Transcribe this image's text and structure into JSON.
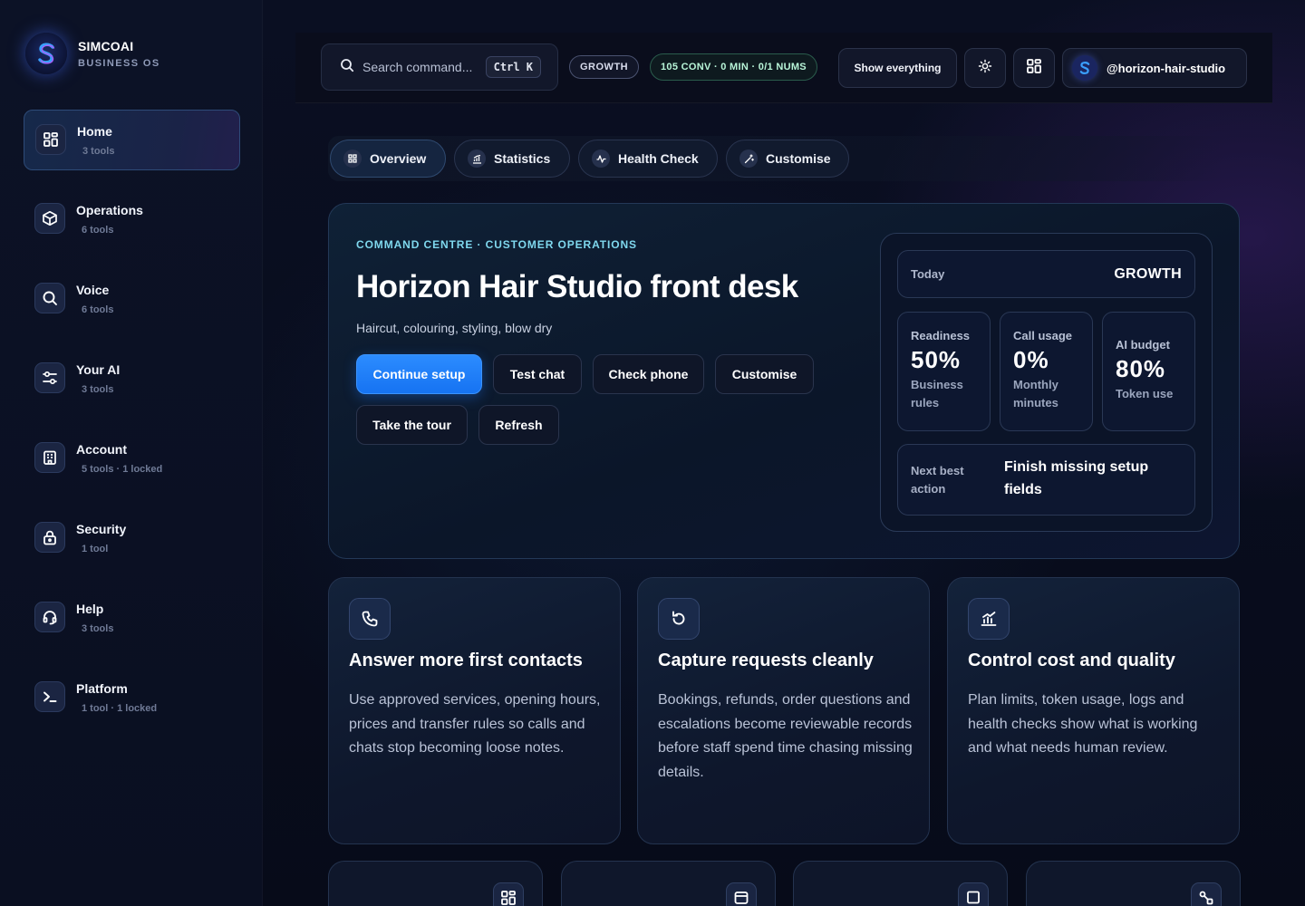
{
  "brand": {
    "name": "SIMCOAI",
    "subtitle": "BUSINESS OS"
  },
  "sidebar": {
    "items": [
      {
        "title": "Home",
        "sub": "3 tools",
        "icon": "grid-icon",
        "active": true
      },
      {
        "title": "Operations",
        "sub": "6 tools",
        "icon": "box-icon"
      },
      {
        "title": "Voice",
        "sub": "6 tools",
        "icon": "search-icon"
      },
      {
        "title": "Your AI",
        "sub": "3 tools",
        "icon": "sliders-icon"
      },
      {
        "title": "Account",
        "sub": "5 tools · 1 locked",
        "icon": "building-icon"
      },
      {
        "title": "Security",
        "sub": "1 tool",
        "icon": "lock-icon"
      },
      {
        "title": "Help",
        "sub": "3 tools",
        "icon": "headset-icon"
      },
      {
        "title": "Platform",
        "sub": "1 tool · 1 locked",
        "icon": "terminal-icon"
      }
    ]
  },
  "topbar": {
    "search_placeholder": "Search command...",
    "shortcut": "Ctrl K",
    "plan_badge": "GROWTH",
    "usage_badge": "105 CONV · 0 MIN · 0/1 NUMS",
    "show_button": "Show everything",
    "profile": "@horizon-hair-studio"
  },
  "tabs": [
    {
      "label": "Overview",
      "icon": "overview-icon"
    },
    {
      "label": "Statistics",
      "icon": "chart-icon"
    },
    {
      "label": "Health Check",
      "icon": "pulse-icon"
    },
    {
      "label": "Customise",
      "icon": "wand-icon"
    }
  ],
  "hero": {
    "eyebrow": "COMMAND CENTRE · CUSTOMER OPERATIONS",
    "title": "Horizon Hair Studio front desk",
    "subtitle": "Haircut, colouring, styling, blow dry",
    "buttons": {
      "continue": "Continue setup",
      "test_chat": "Test chat",
      "check_phone": "Check phone",
      "customise": "Customise",
      "tour": "Take the tour",
      "refresh": "Refresh"
    }
  },
  "stats": {
    "today_label": "Today",
    "today_value": "GROWTH",
    "readiness": {
      "label": "Readiness",
      "value": "50%",
      "sub": "Business rules"
    },
    "call_usage": {
      "label": "Call usage",
      "value": "0%",
      "sub": "Monthly minutes"
    },
    "ai_budget": {
      "label": "AI budget",
      "value": "80%",
      "sub": "Token use"
    },
    "next_label": "Next best action",
    "next_value": "Finish missing setup fields"
  },
  "cards": [
    {
      "title": "Answer more first contacts",
      "body": "Use approved services, opening hours, prices and transfer rules so calls and chats stop becoming loose notes.",
      "icon": "phone-icon"
    },
    {
      "title": "Capture requests cleanly",
      "body": "Bookings, refunds, order questions and escalations become reviewable records before staff spend time chasing missing details.",
      "icon": "refresh-icon"
    },
    {
      "title": "Control cost and quality",
      "body": "Plan limits, token usage, logs and health checks show what is working and what needs human review.",
      "icon": "chart-icon"
    }
  ],
  "colors": {
    "accent": "#1f7cff",
    "eyebrow": "#7fd8ee",
    "background": "#070b18"
  }
}
